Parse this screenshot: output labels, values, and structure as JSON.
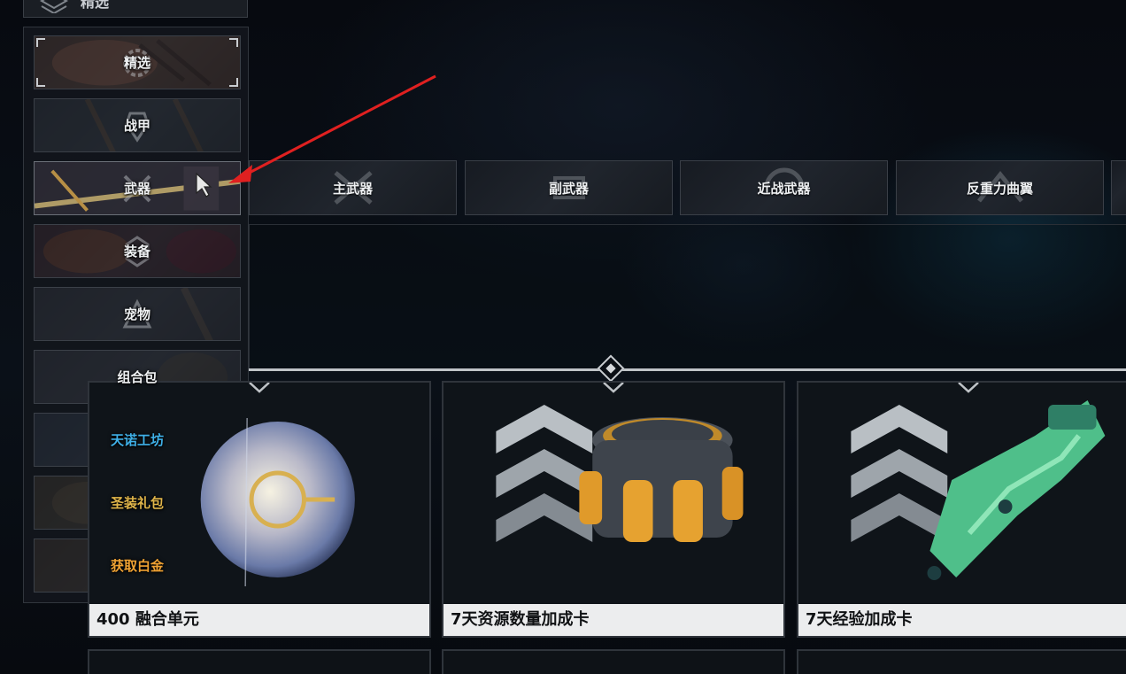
{
  "header": {
    "label": "精选"
  },
  "sidebar": {
    "items": [
      {
        "label": "精选",
        "icon": "gear-icon"
      },
      {
        "label": "战甲",
        "icon": "warframe-icon"
      },
      {
        "label": "武器",
        "icon": "weapon-icon"
      },
      {
        "label": "装备",
        "icon": "gear-up-icon"
      },
      {
        "label": "宠物",
        "icon": "pet-icon"
      },
      {
        "label": "组合包",
        "icon": "bundle-icon"
      },
      {
        "label": "天诺工坊",
        "icon": "workshop-icon"
      },
      {
        "label": "圣装礼包",
        "icon": "prime-icon"
      },
      {
        "label": "获取白金",
        "icon": "platinum-icon"
      }
    ],
    "selected_index": 2
  },
  "subcategories": {
    "items": [
      {
        "label": "主武器"
      },
      {
        "label": "副武器"
      },
      {
        "label": "近战武器"
      },
      {
        "label": "反重力曲翼"
      }
    ]
  },
  "products": [
    {
      "name": "400 融合单元",
      "icon": "fusion-core-orb-icon"
    },
    {
      "name": "7天资源数量加成卡",
      "icon": "resource-booster-icon"
    },
    {
      "name": "7天经验加成卡",
      "icon": "affinity-booster-icon"
    }
  ],
  "colors": {
    "accent_blue": "#3fb0e8",
    "accent_gold": "#e0b54a",
    "accent_orange": "#f0a233",
    "annotation_red": "#e02020"
  }
}
